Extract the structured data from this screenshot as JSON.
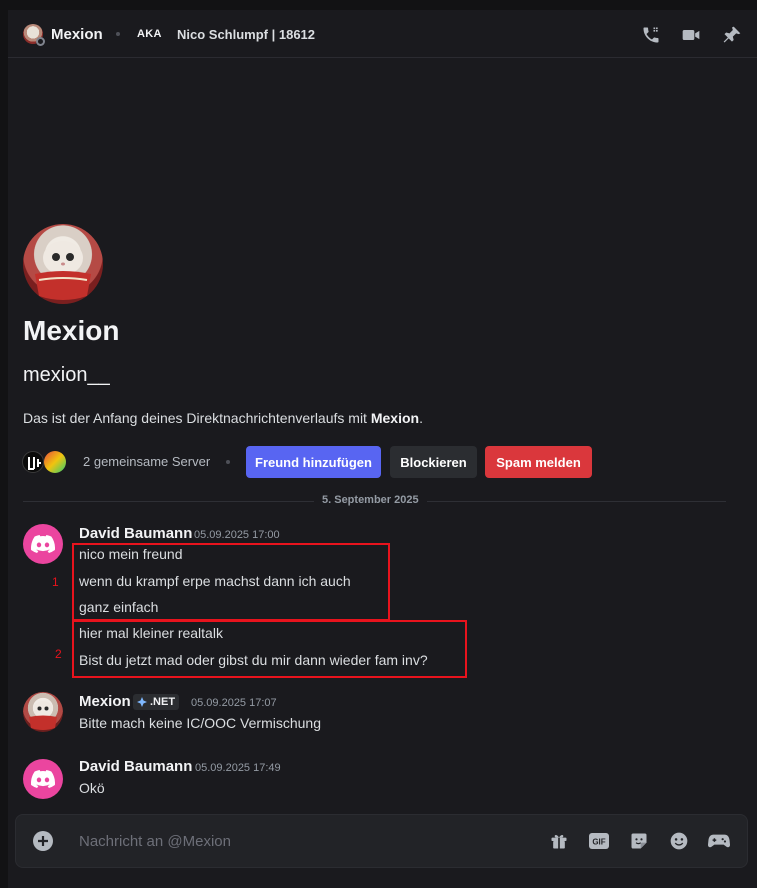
{
  "header": {
    "name": "Mexion",
    "aka_label": "AKA",
    "alias": "Nico Schlumpf | 18612",
    "icons": [
      "phone-icon",
      "video-camera-icon",
      "pin-icon"
    ]
  },
  "intro": {
    "display_name": "Mexion",
    "username": "mexion__",
    "start_text": "Das ist der Anfang deines Direktnachrichtenverlaufs mit ",
    "start_name": "Mexion",
    "start_end": ".",
    "mutual_servers": "2 gemeinsame Server",
    "add_friend": "Freund hinzufügen",
    "block": "Blockieren",
    "report_spam": "Spam melden"
  },
  "date_divider": "5. September 2025",
  "messages": [
    {
      "author": "David Baumann",
      "timestamp": "05.09.2025 17:00",
      "lines": [
        "nico mein freund",
        "wenn du krampf erpe machst dann ich auch",
        "ganz einfach",
        "hier mal kleiner realtalk",
        "Bist du jetzt mad oder gibst du mir dann wieder fam inv?"
      ]
    },
    {
      "author": "Mexion",
      "tag": ".NET",
      "timestamp": "05.09.2025 17:07",
      "lines": [
        "Bitte mach keine IC/OOC Vermischung"
      ]
    },
    {
      "author": "David Baumann",
      "timestamp": "05.09.2025 17:49",
      "lines": [
        "Okö"
      ]
    }
  ],
  "annotations": [
    "1",
    "2"
  ],
  "composer": {
    "placeholder": "Nachricht an @Mexion",
    "icons": [
      "gift-icon",
      "gif-icon",
      "sticker-icon",
      "emoji-icon",
      "gamepad-icon"
    ],
    "gif_label": "GIF"
  },
  "colors": {
    "background": "#1a1a1e",
    "blurple": "#5865f2",
    "danger": "#da373c",
    "secondary_button": "#2b2d31",
    "discord_pink": "#eb459f",
    "annotation_red": "#e8131d"
  }
}
